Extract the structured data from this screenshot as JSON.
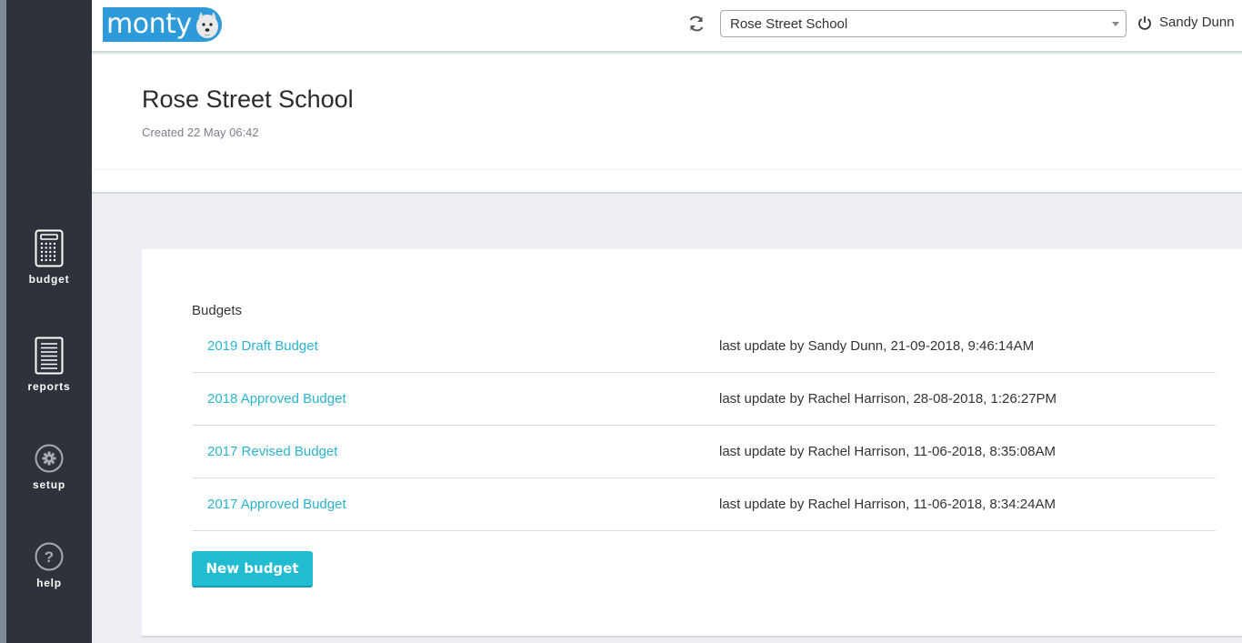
{
  "app": {
    "logo_text": "monty",
    "brand_color": "#2f9ad9",
    "accent_color": "#22bcd2"
  },
  "sidebar": {
    "items": [
      {
        "label": "budget",
        "icon": "calculator-icon"
      },
      {
        "label": "reports",
        "icon": "document-icon"
      },
      {
        "label": "setup",
        "icon": "gear-icon"
      },
      {
        "label": "help",
        "icon": "question-icon"
      }
    ]
  },
  "topbar": {
    "refresh_icon": "refresh-icon",
    "school_select": {
      "value": "Rose Street School"
    },
    "user": {
      "icon": "power-icon",
      "name": "Sandy Dunn"
    }
  },
  "header": {
    "title": "Rose Street School",
    "created": "Created 22 May 06:42"
  },
  "budgets": {
    "section_label": "Budgets",
    "rows": [
      {
        "name": "2019 Draft Budget",
        "last_update": "last update by Sandy Dunn, 21-09-2018, 9:46:14AM"
      },
      {
        "name": "2018 Approved Budget",
        "last_update": "last update by Rachel Harrison, 28-08-2018, 1:26:27PM"
      },
      {
        "name": "2017 Revised Budget",
        "last_update": "last update by Rachel Harrison, 11-06-2018, 8:35:08AM"
      },
      {
        "name": "2017 Approved Budget",
        "last_update": "last update by Rachel Harrison, 11-06-2018, 8:34:24AM"
      }
    ],
    "new_button": "New budget"
  }
}
